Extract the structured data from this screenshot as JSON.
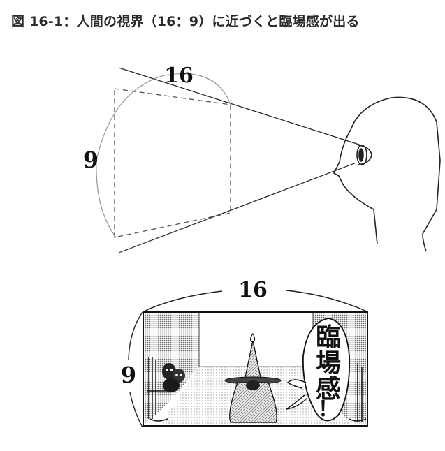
{
  "figure": {
    "caption": "図 16-1：人間の視界（16：9）に近づくと臨場感が出る"
  },
  "top_diagram": {
    "width_label": "16",
    "height_label": "9"
  },
  "bottom_diagram": {
    "width_label": "16",
    "height_label": "9",
    "speech_bubble": {
      "chars": [
        "臨",
        "場",
        "感",
        "！"
      ]
    }
  },
  "colors": {
    "line": "#222222",
    "dashed": "#555555",
    "caption": "#2b2b2b",
    "screentone": "#9a9a9a"
  }
}
